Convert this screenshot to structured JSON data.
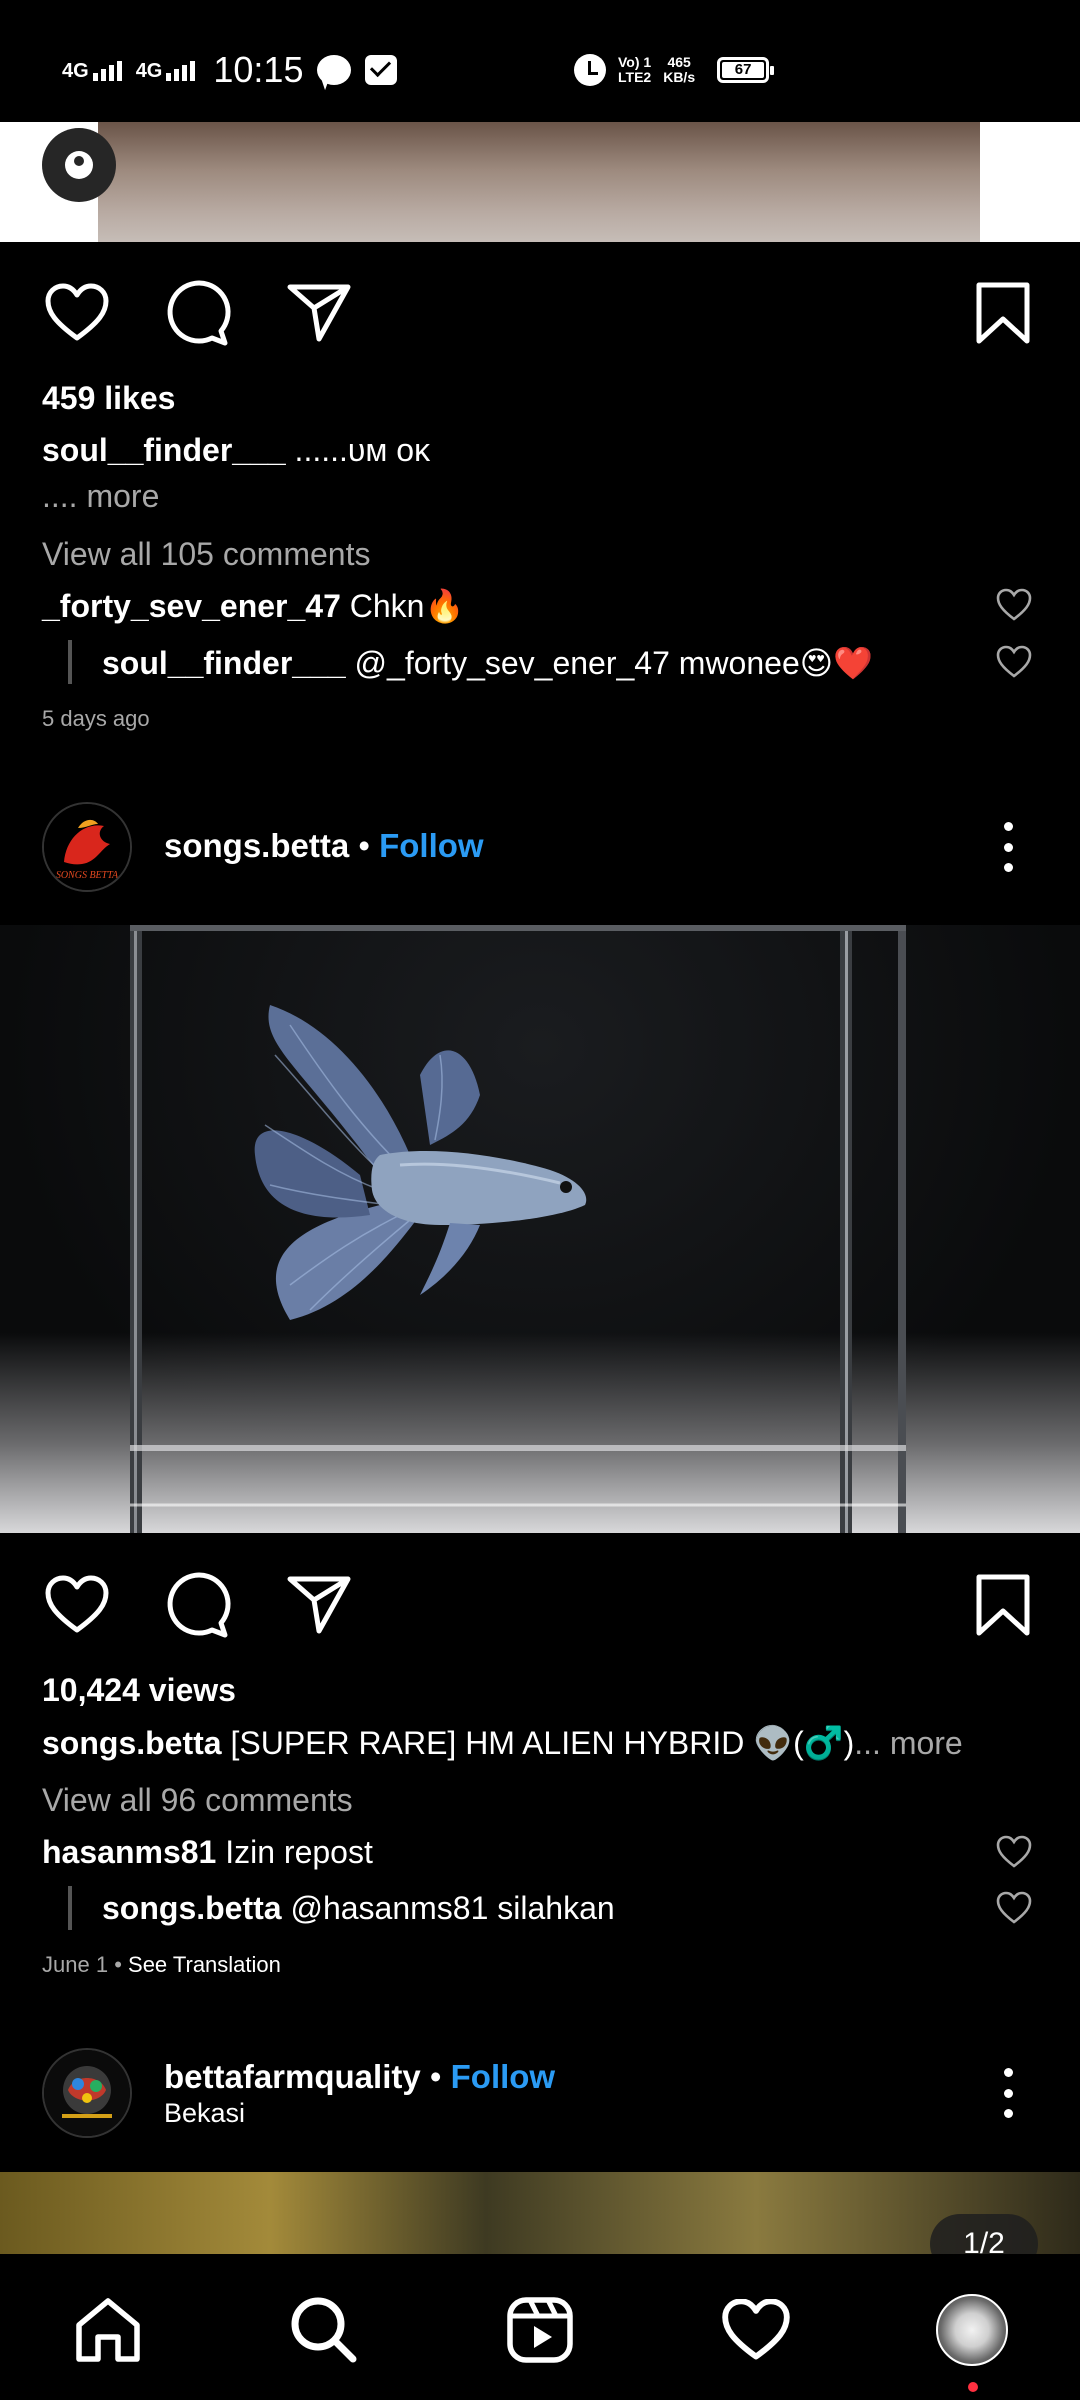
{
  "status_bar": {
    "net1": "4G",
    "net2": "4G",
    "time": "10:15",
    "volte_top": "Vo) 1",
    "volte_bottom": "LTE2",
    "speed_top": "465",
    "speed_bottom": "KB/s",
    "battery": "67"
  },
  "post1": {
    "likes": "459 likes",
    "caption_user": "soul__finder___",
    "caption_text": "......ᴜᴍ ᴏᴋ",
    "more": ".... more",
    "view_comments": "View all 105 comments",
    "comment1_user": "_forty_sev_ener_47",
    "comment1_text": "Chkn🔥",
    "reply_user": "soul__finder___",
    "reply_text": "@_forty_sev_ener_47 mwonee😍❤️",
    "timestamp": "5 days ago"
  },
  "post2": {
    "username": "songs.betta",
    "separator": "•",
    "follow": "Follow",
    "avatar_text": "SONGS BETTA",
    "views": "10,424 views",
    "caption_user": "songs.betta",
    "caption_text": "[SUPER RARE] HM ALIEN HYBRID 👽(♂️)",
    "more": "... more",
    "view_comments": "View all 96 comments",
    "comment1_user": "hasanms81",
    "comment1_text": "Izin repost",
    "reply_user": "songs.betta",
    "reply_text": "@hasanms81 silahkan",
    "timestamp": "June 1",
    "see_translation": "See Translation"
  },
  "post3": {
    "username": "bettafarmquality",
    "separator": "•",
    "follow": "Follow",
    "location": "Bekasi",
    "counter": "1/2"
  },
  "colors": {
    "background": "#000000",
    "follow_blue": "#2b9bf4",
    "secondary_text": "#a8a8a8",
    "notification_dot": "#ff3040"
  }
}
